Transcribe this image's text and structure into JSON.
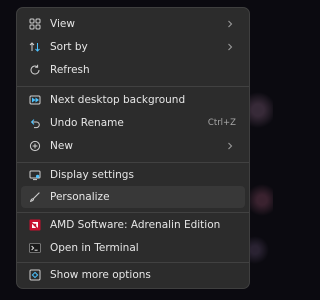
{
  "menu": {
    "items": [
      {
        "label": "View",
        "icon": "view-grid-icon",
        "submenu": true
      },
      {
        "label": "Sort by",
        "icon": "sort-icon",
        "submenu": true
      },
      {
        "label": "Refresh",
        "icon": "refresh-icon"
      },
      {
        "label": "Next desktop background",
        "icon": "next-background-icon"
      },
      {
        "label": "Undo Rename",
        "icon": "undo-icon",
        "shortcut": "Ctrl+Z"
      },
      {
        "label": "New",
        "icon": "new-icon",
        "submenu": true
      },
      {
        "label": "Display settings",
        "icon": "display-icon"
      },
      {
        "label": "Personalize",
        "icon": "personalize-brush-icon",
        "highlighted": true
      },
      {
        "label": "AMD Software: Adrenalin Edition",
        "icon": "amd-logo-icon"
      },
      {
        "label": "Open in Terminal",
        "icon": "terminal-icon"
      },
      {
        "label": "Show more options",
        "icon": "more-options-icon"
      }
    ]
  },
  "colors": {
    "menu_bg": "#2c2c2c",
    "hover_bg": "#383838",
    "text": "#e6e6e6",
    "accent_blue": "#4cc2ff",
    "amd_red": "#c8102e"
  }
}
